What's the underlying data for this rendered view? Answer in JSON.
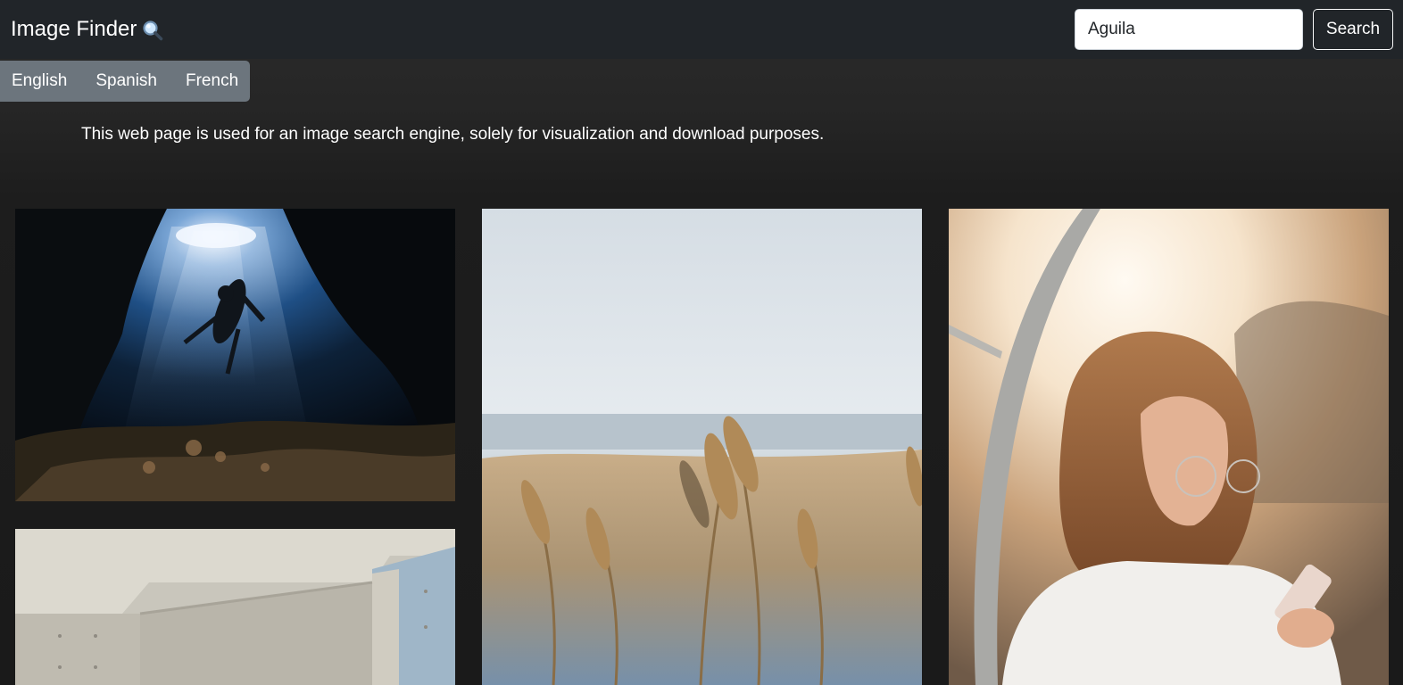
{
  "navbar": {
    "brand": "Image Finder",
    "brand_icon": "magnifying-glass-icon",
    "search_value": "Aguila",
    "search_button": "Search"
  },
  "languages": [
    "English",
    "Spanish",
    "French"
  ],
  "intro_text": "This web page is used for an image search engine, solely for visualization and download purposes.",
  "results": [
    {
      "subject": "diver-in-underwater-cave"
    },
    {
      "subject": "concrete-room-interior"
    },
    {
      "subject": "dry-grass-by-the-sea"
    },
    {
      "subject": "woman-with-phone-at-sunset"
    }
  ],
  "colors": {
    "navbar": "#212529",
    "lang_bar": "#6c757d",
    "background": "#1a1a1a",
    "text": "#ffffff"
  }
}
